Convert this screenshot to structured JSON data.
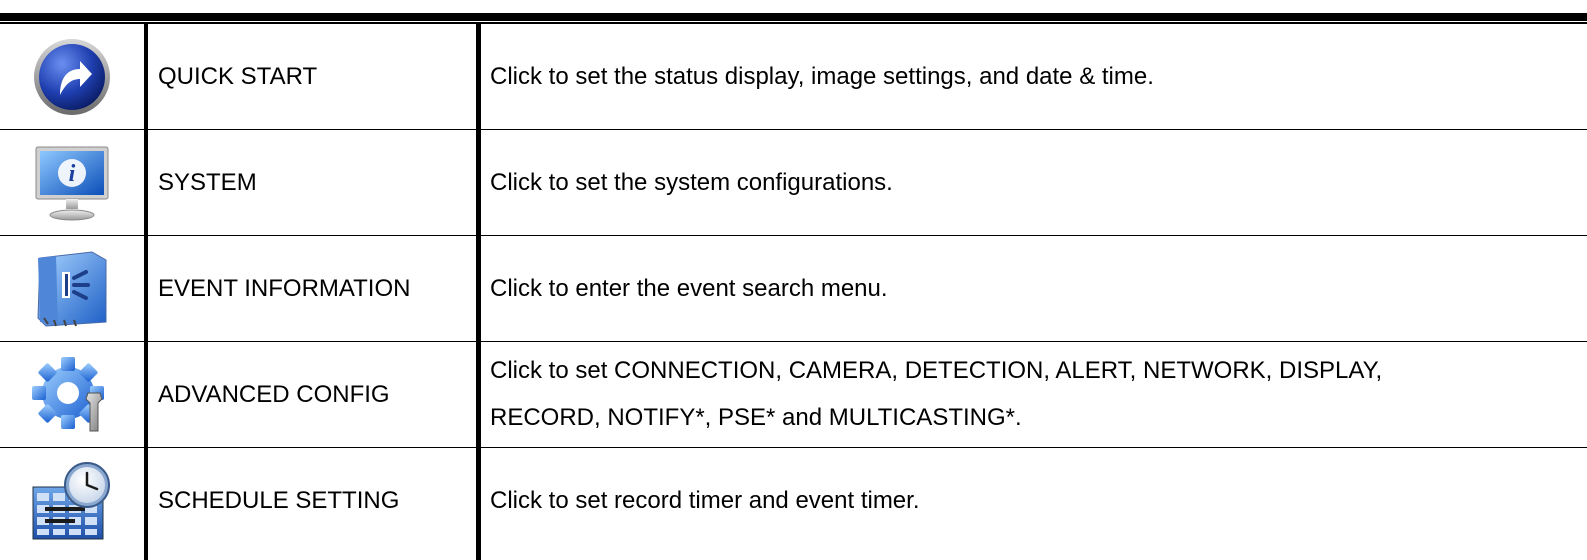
{
  "rows": [
    {
      "icon": "quick-start-icon",
      "name": "QUICK START",
      "description": "Click to set the status display, image settings, and date & time."
    },
    {
      "icon": "system-info-icon",
      "name": "SYSTEM",
      "description": "Click to set the system configurations."
    },
    {
      "icon": "event-information-icon",
      "name": "EVENT INFORMATION",
      "description": "Click to enter the event search menu."
    },
    {
      "icon": "advanced-config-icon",
      "name": "ADVANCED CONFIG",
      "description_lines": [
        "Click to set CONNECTION, CAMERA, DETECTION, ALERT, NETWORK, DISPLAY,",
        "RECORD, NOTIFY*, PSE* and MULTICASTING*."
      ]
    },
    {
      "icon": "schedule-setting-icon",
      "name": "SCHEDULE SETTING",
      "description": "Click to set record timer and event timer."
    }
  ]
}
